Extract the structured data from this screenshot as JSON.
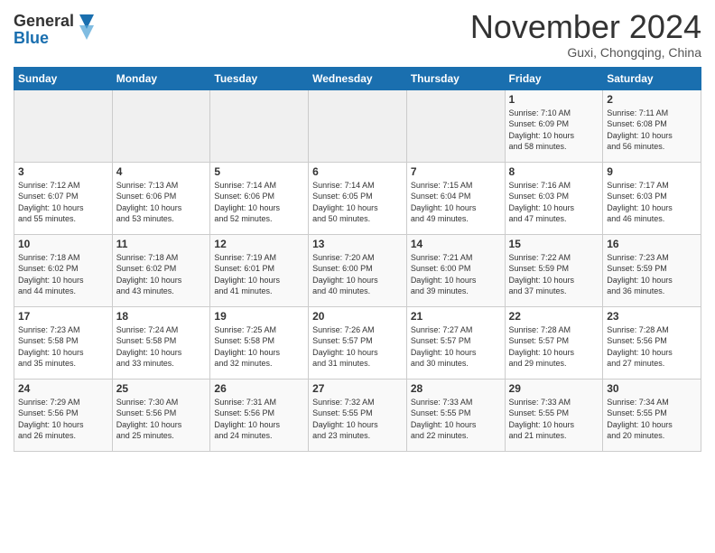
{
  "header": {
    "logo_general": "General",
    "logo_blue": "Blue",
    "month_title": "November 2024",
    "location": "Guxi, Chongqing, China"
  },
  "weekdays": [
    "Sunday",
    "Monday",
    "Tuesday",
    "Wednesday",
    "Thursday",
    "Friday",
    "Saturday"
  ],
  "weeks": [
    [
      {
        "day": "",
        "info": ""
      },
      {
        "day": "",
        "info": ""
      },
      {
        "day": "",
        "info": ""
      },
      {
        "day": "",
        "info": ""
      },
      {
        "day": "",
        "info": ""
      },
      {
        "day": "1",
        "info": "Sunrise: 7:10 AM\nSunset: 6:09 PM\nDaylight: 10 hours\nand 58 minutes."
      },
      {
        "day": "2",
        "info": "Sunrise: 7:11 AM\nSunset: 6:08 PM\nDaylight: 10 hours\nand 56 minutes."
      }
    ],
    [
      {
        "day": "3",
        "info": "Sunrise: 7:12 AM\nSunset: 6:07 PM\nDaylight: 10 hours\nand 55 minutes."
      },
      {
        "day": "4",
        "info": "Sunrise: 7:13 AM\nSunset: 6:06 PM\nDaylight: 10 hours\nand 53 minutes."
      },
      {
        "day": "5",
        "info": "Sunrise: 7:14 AM\nSunset: 6:06 PM\nDaylight: 10 hours\nand 52 minutes."
      },
      {
        "day": "6",
        "info": "Sunrise: 7:14 AM\nSunset: 6:05 PM\nDaylight: 10 hours\nand 50 minutes."
      },
      {
        "day": "7",
        "info": "Sunrise: 7:15 AM\nSunset: 6:04 PM\nDaylight: 10 hours\nand 49 minutes."
      },
      {
        "day": "8",
        "info": "Sunrise: 7:16 AM\nSunset: 6:03 PM\nDaylight: 10 hours\nand 47 minutes."
      },
      {
        "day": "9",
        "info": "Sunrise: 7:17 AM\nSunset: 6:03 PM\nDaylight: 10 hours\nand 46 minutes."
      }
    ],
    [
      {
        "day": "10",
        "info": "Sunrise: 7:18 AM\nSunset: 6:02 PM\nDaylight: 10 hours\nand 44 minutes."
      },
      {
        "day": "11",
        "info": "Sunrise: 7:18 AM\nSunset: 6:02 PM\nDaylight: 10 hours\nand 43 minutes."
      },
      {
        "day": "12",
        "info": "Sunrise: 7:19 AM\nSunset: 6:01 PM\nDaylight: 10 hours\nand 41 minutes."
      },
      {
        "day": "13",
        "info": "Sunrise: 7:20 AM\nSunset: 6:00 PM\nDaylight: 10 hours\nand 40 minutes."
      },
      {
        "day": "14",
        "info": "Sunrise: 7:21 AM\nSunset: 6:00 PM\nDaylight: 10 hours\nand 39 minutes."
      },
      {
        "day": "15",
        "info": "Sunrise: 7:22 AM\nSunset: 5:59 PM\nDaylight: 10 hours\nand 37 minutes."
      },
      {
        "day": "16",
        "info": "Sunrise: 7:23 AM\nSunset: 5:59 PM\nDaylight: 10 hours\nand 36 minutes."
      }
    ],
    [
      {
        "day": "17",
        "info": "Sunrise: 7:23 AM\nSunset: 5:58 PM\nDaylight: 10 hours\nand 35 minutes."
      },
      {
        "day": "18",
        "info": "Sunrise: 7:24 AM\nSunset: 5:58 PM\nDaylight: 10 hours\nand 33 minutes."
      },
      {
        "day": "19",
        "info": "Sunrise: 7:25 AM\nSunset: 5:58 PM\nDaylight: 10 hours\nand 32 minutes."
      },
      {
        "day": "20",
        "info": "Sunrise: 7:26 AM\nSunset: 5:57 PM\nDaylight: 10 hours\nand 31 minutes."
      },
      {
        "day": "21",
        "info": "Sunrise: 7:27 AM\nSunset: 5:57 PM\nDaylight: 10 hours\nand 30 minutes."
      },
      {
        "day": "22",
        "info": "Sunrise: 7:28 AM\nSunset: 5:57 PM\nDaylight: 10 hours\nand 29 minutes."
      },
      {
        "day": "23",
        "info": "Sunrise: 7:28 AM\nSunset: 5:56 PM\nDaylight: 10 hours\nand 27 minutes."
      }
    ],
    [
      {
        "day": "24",
        "info": "Sunrise: 7:29 AM\nSunset: 5:56 PM\nDaylight: 10 hours\nand 26 minutes."
      },
      {
        "day": "25",
        "info": "Sunrise: 7:30 AM\nSunset: 5:56 PM\nDaylight: 10 hours\nand 25 minutes."
      },
      {
        "day": "26",
        "info": "Sunrise: 7:31 AM\nSunset: 5:56 PM\nDaylight: 10 hours\nand 24 minutes."
      },
      {
        "day": "27",
        "info": "Sunrise: 7:32 AM\nSunset: 5:55 PM\nDaylight: 10 hours\nand 23 minutes."
      },
      {
        "day": "28",
        "info": "Sunrise: 7:33 AM\nSunset: 5:55 PM\nDaylight: 10 hours\nand 22 minutes."
      },
      {
        "day": "29",
        "info": "Sunrise: 7:33 AM\nSunset: 5:55 PM\nDaylight: 10 hours\nand 21 minutes."
      },
      {
        "day": "30",
        "info": "Sunrise: 7:34 AM\nSunset: 5:55 PM\nDaylight: 10 hours\nand 20 minutes."
      }
    ]
  ]
}
